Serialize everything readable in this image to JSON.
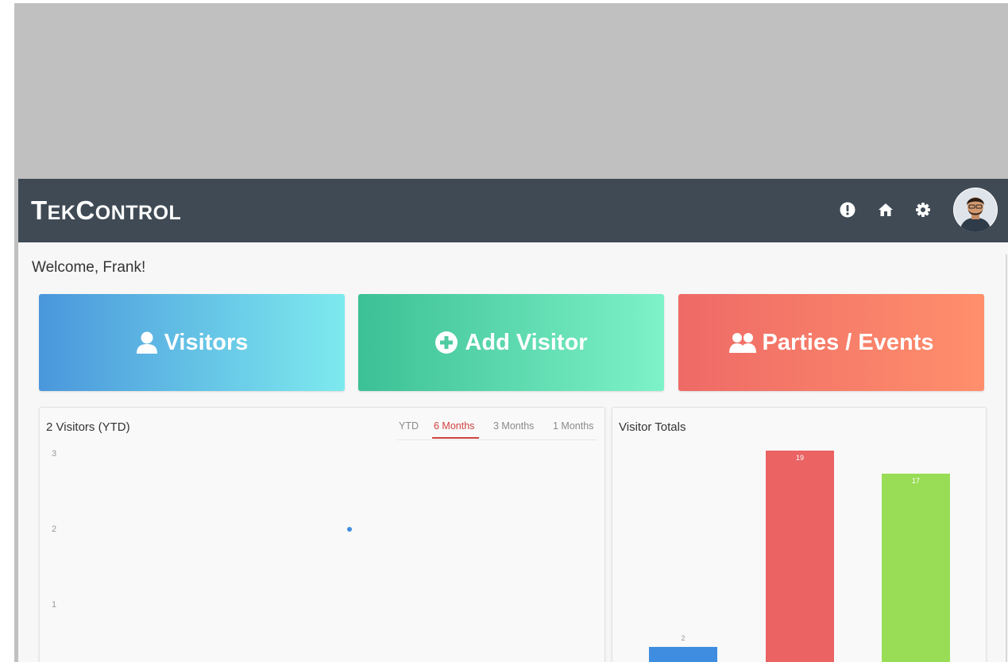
{
  "app": {
    "logo": {
      "first_big": "T",
      "first_small": "EK",
      "second_big": "C",
      "second_small": "ONTROL"
    },
    "nav_icons": [
      "alert-icon",
      "home-icon",
      "gear-icon"
    ],
    "welcome": "Welcome, Frank!"
  },
  "tiles": [
    {
      "label": "Visitors",
      "icon": "user-icon",
      "colors": [
        "#4a97dc",
        "#7deaee"
      ]
    },
    {
      "label": "Add Visitor",
      "icon": "plus-circle-icon",
      "colors": [
        "#3cc095",
        "#7ef2c8"
      ]
    },
    {
      "label": "Parties / Events",
      "icon": "users-icon",
      "colors": [
        "#ee6a66",
        "#ff8f6c"
      ]
    }
  ],
  "visitors_chart": {
    "title": "2 Visitors (YTD)",
    "tabs": [
      "YTD",
      "6 Months",
      "3 Months",
      "1 Months"
    ],
    "active_tab": "6 Months"
  },
  "totals_chart": {
    "title": "Visitor Totals"
  },
  "chart_data": [
    {
      "type": "scatter",
      "title": "2 Visitors (YTD)",
      "y_ticks": [
        "3",
        "2",
        "1"
      ],
      "ylim": [
        0,
        3
      ],
      "points": [
        {
          "y": 2
        }
      ],
      "color": "#3f8de0"
    },
    {
      "type": "bar",
      "title": "Visitor Totals",
      "values": [
        2,
        19,
        17
      ],
      "value_labels": [
        "2",
        "19",
        "17"
      ],
      "colors": [
        "#3f8de0",
        "#eb6363",
        "#98dd55"
      ],
      "ylim": [
        0,
        20
      ]
    }
  ]
}
